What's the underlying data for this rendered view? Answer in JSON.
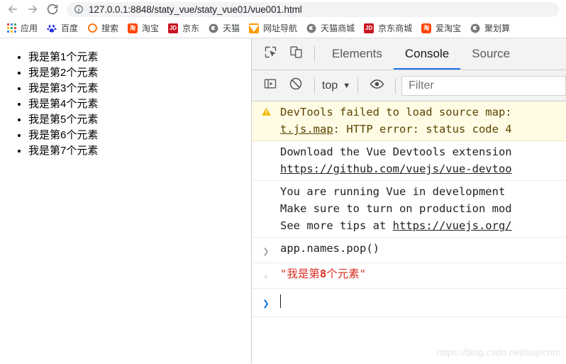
{
  "browser": {
    "nav": {
      "back_icon": "arrow-left-icon",
      "forward_icon": "arrow-right-icon",
      "reload_icon": "reload-icon"
    },
    "omnibox": {
      "info_icon": "page-info-icon",
      "url": "127.0.0.1:8848/staty_vue/staty_vue01/vue001.html"
    },
    "bookmarks": [
      {
        "label": "应用",
        "icon": "apps-grid-icon",
        "icon_kind": "apps",
        "color": "#4285f4"
      },
      {
        "label": "百度",
        "icon": "baidu-icon",
        "icon_kind": "baidu",
        "color": "#2932e1"
      },
      {
        "label": "搜索",
        "icon": "search-ring-icon",
        "icon_kind": "ring",
        "color": "#ff7a18"
      },
      {
        "label": "淘宝",
        "icon": "taobao-icon",
        "icon_kind": "taobao",
        "color": "#ff4400"
      },
      {
        "label": "京东",
        "icon": "jd-icon",
        "icon_kind": "jd",
        "color": "#c81623"
      },
      {
        "label": "天猫",
        "icon": "globe-icon",
        "icon_kind": "globe",
        "color": "#7a7a7a"
      },
      {
        "label": "网址导航",
        "icon": "hao123-icon",
        "icon_kind": "tri",
        "color": "#ff9900"
      },
      {
        "label": "天猫商城",
        "icon": "globe-icon",
        "icon_kind": "globe",
        "color": "#7a7a7a"
      },
      {
        "label": "京东商城",
        "icon": "jd-icon",
        "icon_kind": "jd",
        "color": "#c81623"
      },
      {
        "label": "爱淘宝",
        "icon": "taobao-icon",
        "icon_kind": "taobao",
        "color": "#ff4400"
      },
      {
        "label": "聚划算",
        "icon": "globe-icon",
        "icon_kind": "globe",
        "color": "#7a7a7a"
      }
    ]
  },
  "page": {
    "list_items": [
      "我是第1个元素",
      "我是第2个元素",
      "我是第3个元素",
      "我是第4个元素",
      "我是第5个元素",
      "我是第6个元素",
      "我是第7个元素"
    ]
  },
  "devtools": {
    "inspect_icon": "inspect-element-icon",
    "device_icon": "device-toolbar-icon",
    "tabs": [
      {
        "label": "Elements",
        "active": false
      },
      {
        "label": "Console",
        "active": true
      },
      {
        "label": "Source",
        "active": false
      }
    ],
    "console_toolbar": {
      "sidebar_icon": "console-sidebar-icon",
      "clear_icon": "clear-console-icon",
      "context": "top",
      "context_caret": "▼",
      "eye_icon": "live-expression-icon",
      "filter_placeholder": "Filter"
    },
    "messages": [
      {
        "type": "warning",
        "icon": "warning-triangle-icon",
        "lines": [
          [
            {
              "t": "DevTools failed to load source map:",
              "link": false
            }
          ],
          [
            {
              "t": "t.js.map",
              "link": true
            },
            {
              "t": ": HTTP error: status code 4",
              "link": false
            }
          ]
        ]
      },
      {
        "type": "log",
        "icon": "",
        "lines": [
          [
            {
              "t": "Download the Vue Devtools extension",
              "link": false
            }
          ],
          [
            {
              "t": "https://github.com/vuejs/vue-devtoo",
              "link": true
            }
          ]
        ]
      },
      {
        "type": "log",
        "icon": "",
        "lines": [
          [
            {
              "t": "You are running Vue in development",
              "link": false
            }
          ],
          [
            {
              "t": "Make sure to turn on production mod",
              "link": false
            }
          ],
          [
            {
              "t": "See more tips at ",
              "link": false
            },
            {
              "t": "https://vuejs.org/",
              "link": true
            }
          ]
        ]
      },
      {
        "type": "input",
        "icon": "input-arrow-icon",
        "arrow": "❯",
        "lines": [
          [
            {
              "t": "app.names.pop()",
              "link": false
            }
          ]
        ]
      },
      {
        "type": "result",
        "icon": "output-arrow-icon",
        "arrow": "‹",
        "lines": [
          [
            {
              "t": "\"我是第8个元素\"",
              "link": false
            }
          ]
        ]
      }
    ],
    "prompt": {
      "arrow": "❯",
      "value": ""
    }
  },
  "watermark": "https://blog.csdn.net/ouyicnm"
}
